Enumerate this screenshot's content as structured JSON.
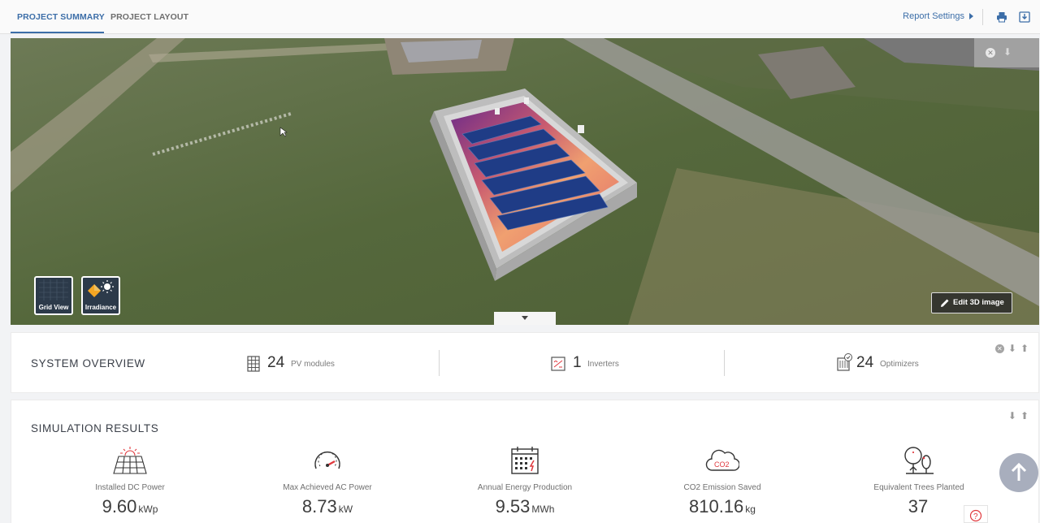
{
  "tabs": [
    {
      "label": "PROJECT SUMMARY",
      "active": true
    },
    {
      "label": "PROJECT LAYOUT",
      "active": false
    }
  ],
  "toolbar": {
    "report_settings_label": "Report Settings",
    "print_icon": "print-icon",
    "download_icon": "download-icon"
  },
  "viewer": {
    "view_buttons": [
      {
        "label": "Grid View",
        "icon": "grid-view-icon"
      },
      {
        "label": "Irradiance",
        "icon": "irradiance-icon"
      }
    ],
    "edit_label": "Edit 3D image"
  },
  "system_overview": {
    "title": "SYSTEM OVERVIEW",
    "items": [
      {
        "value": "24",
        "label": "PV modules",
        "icon": "pv-module-icon"
      },
      {
        "value": "1",
        "label": "Inverters",
        "icon": "inverter-icon"
      },
      {
        "value": "24",
        "label": "Optimizers",
        "icon": "optimizer-icon"
      }
    ]
  },
  "simulation_results": {
    "title": "SIMULATION RESULTS",
    "items": [
      {
        "label": "Installed DC Power",
        "value": "9.60",
        "unit": "kWp",
        "icon": "solar-panel-icon"
      },
      {
        "label": "Max Achieved AC Power",
        "value": "8.73",
        "unit": "kW",
        "icon": "gauge-icon"
      },
      {
        "label": "Annual Energy Production",
        "value": "9.53",
        "unit": "MWh",
        "icon": "calendar-icon"
      },
      {
        "label": "CO2 Emission Saved",
        "value": "810.16",
        "unit": "kg",
        "icon": "co2-cloud-icon"
      },
      {
        "label": "Equivalent Trees Planted",
        "value": "37",
        "unit": "",
        "icon": "trees-icon"
      }
    ]
  },
  "colors": {
    "accent": "#3c6ea8",
    "icon_red": "#e0393e",
    "fab": "#a8aebd"
  }
}
